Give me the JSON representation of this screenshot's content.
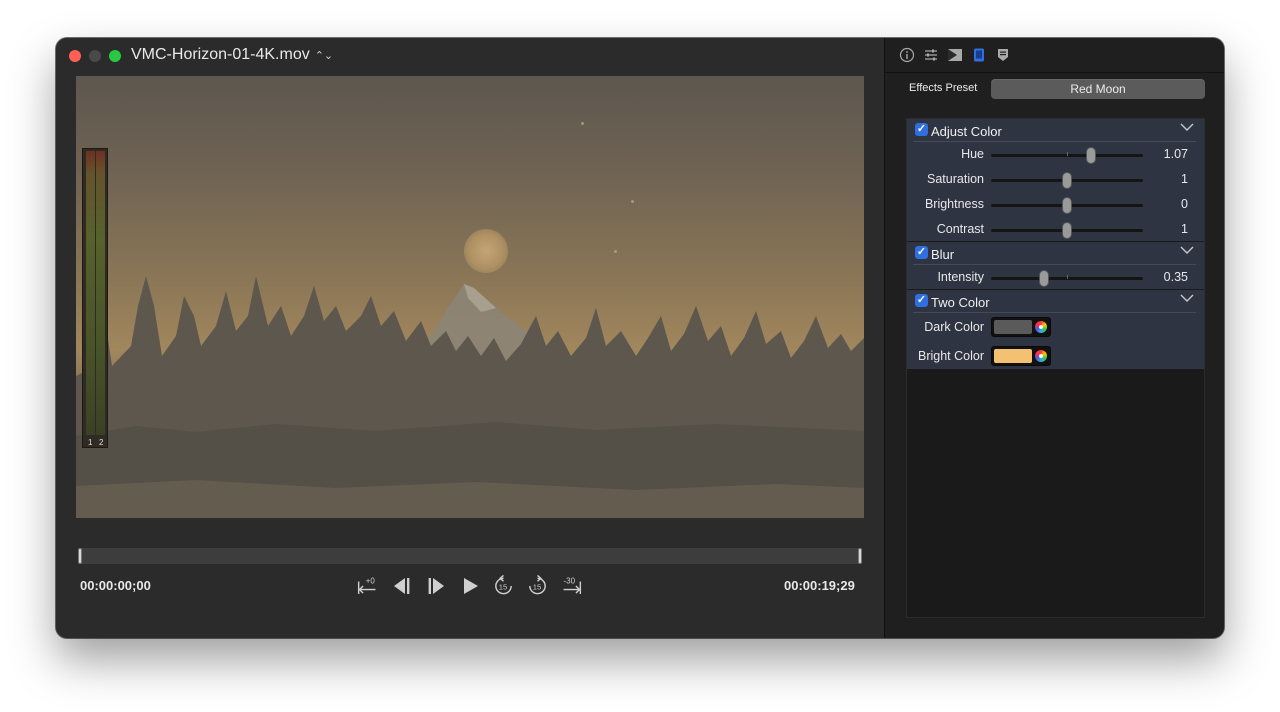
{
  "window": {
    "title": "VMC-Horizon-01-4K.mov",
    "title_arrows": "⌃⌄"
  },
  "player": {
    "meter_labels": [
      "1",
      "2"
    ],
    "time_current": "00:00:00;00",
    "time_end": "00:00:19;29",
    "controls": {
      "jump_back_label": "+0",
      "skip_back_label": "15",
      "skip_forward_label": "15",
      "jump_forward_label": "-30"
    }
  },
  "inspector": {
    "tabs": [
      "info-icon",
      "sliders-icon",
      "effects-icon",
      "color-icon",
      "marker-icon"
    ],
    "preset_label": "Effects Preset",
    "preset_value": "Red Moon",
    "sections": {
      "adjust": {
        "title": "Adjust Color",
        "checked": true,
        "rows": [
          {
            "label": "Hue",
            "value": "1.07",
            "fraction": 0.66
          },
          {
            "label": "Saturation",
            "value": "1",
            "fraction": 0.5
          },
          {
            "label": "Brightness",
            "value": "0",
            "fraction": 0.5
          },
          {
            "label": "Contrast",
            "value": "1",
            "fraction": 0.5
          }
        ]
      },
      "blur": {
        "title": "Blur",
        "checked": true,
        "rows": [
          {
            "label": "Intensity",
            "value": "0.35",
            "fraction": 0.35
          }
        ]
      },
      "two_color": {
        "title": "Two Color",
        "checked": true,
        "dark_label": "Dark Color",
        "dark_color": "#5a5a5a",
        "bright_label": "Bright Color",
        "bright_color": "#f4c071"
      }
    }
  }
}
